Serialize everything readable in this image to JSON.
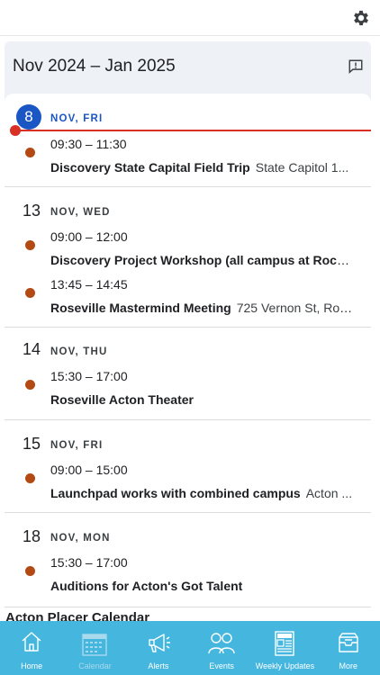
{
  "header": {
    "settings_icon": "gear-icon"
  },
  "calendar": {
    "range": "Nov 2024 – Jan 2025",
    "feedback_icon": "feedback-icon",
    "days": [
      {
        "num": "8",
        "name": "NOV, FRI",
        "today": true,
        "events": [
          {
            "time": "09:30 – 11:30",
            "title": "Discovery State Capital Field Trip",
            "location": "State Capitol 1..."
          }
        ]
      },
      {
        "num": "13",
        "name": "NOV, WED",
        "events": [
          {
            "time": "09:00 – 12:00",
            "title": "Discovery Project Workshop (all campus at Rocklin)",
            "location": ""
          },
          {
            "time": "13:45 – 14:45",
            "title": "Roseville Mastermind Meeting",
            "location": "725 Vernon St, Ros..."
          }
        ]
      },
      {
        "num": "14",
        "name": "NOV, THU",
        "events": [
          {
            "time": "15:30 – 17:00",
            "title": "Roseville Acton Theater",
            "location": ""
          }
        ]
      },
      {
        "num": "15",
        "name": "NOV, FRI",
        "events": [
          {
            "time": "09:00 – 15:00",
            "title": "Launchpad works with combined campus",
            "location": "Acton ..."
          }
        ]
      },
      {
        "num": "18",
        "name": "NOV, MON",
        "events": [
          {
            "time": "15:30 – 17:00",
            "title": "Auditions for Acton's Got Talent",
            "location": ""
          }
        ]
      }
    ],
    "footer_title": "Acton Placer Calendar",
    "event_color": "#b34a14",
    "today_color": "#1a56c4",
    "now_color": "#d93025"
  },
  "tabbar": {
    "color": "#45b6de",
    "tabs": [
      {
        "label": "Home",
        "icon": "home-icon"
      },
      {
        "label": "Calendar",
        "icon": "calendar-icon",
        "active": true
      },
      {
        "label": "Alerts",
        "icon": "megaphone-icon"
      },
      {
        "label": "Events",
        "icon": "people-icon"
      },
      {
        "label": "Weekly Updates",
        "icon": "newspaper-icon"
      },
      {
        "label": "More",
        "icon": "inbox-icon"
      }
    ]
  }
}
